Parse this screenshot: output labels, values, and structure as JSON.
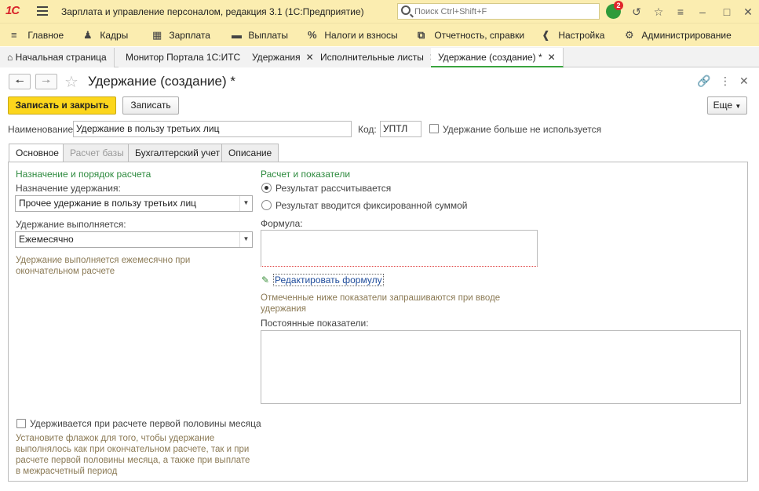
{
  "app": {
    "logo": "1С",
    "title": "Зарплата и управление персоналом, редакция 3.1  (1С:Предприятие)",
    "search_placeholder": "Поиск Ctrl+Shift+F",
    "notifications_count": "2"
  },
  "main_menu": [
    {
      "label": "Главное",
      "icon": "menu-icon"
    },
    {
      "label": "Кадры",
      "icon": "people-icon"
    },
    {
      "label": "Зарплата",
      "icon": "calculator-icon"
    },
    {
      "label": "Выплаты",
      "icon": "wallet-icon"
    },
    {
      "label": "Налоги и взносы",
      "icon": "percent-icon"
    },
    {
      "label": "Отчетность, справки",
      "icon": "reports-icon"
    },
    {
      "label": "Настройка",
      "icon": "wrench-icon"
    },
    {
      "label": "Администрирование",
      "icon": "gear-icon"
    }
  ],
  "window_tabs": [
    {
      "label": "Начальная страница"
    },
    {
      "label": "Монитор Портала 1С:ИТС"
    },
    {
      "label": "Удержания"
    },
    {
      "label": "Исполнительные листы"
    },
    {
      "label": "Удержание (создание) *"
    }
  ],
  "form": {
    "title": "Удержание (создание) *",
    "save_close_label": "Записать и закрыть",
    "save_label": "Записать",
    "more_label": "Еще",
    "name_label": "Наименование:",
    "name_value": "Удержание в пользу третьих лиц",
    "code_label": "Код:",
    "code_value": "УПТЛ",
    "not_used_label": "Удержание больше не используется"
  },
  "tabs": [
    {
      "label": "Основное"
    },
    {
      "label": "Расчет базы"
    },
    {
      "label": "Бухгалтерский учет"
    },
    {
      "label": "Описание"
    }
  ],
  "left": {
    "section_title": "Назначение и порядок расчета",
    "purpose_label": "Назначение удержания:",
    "purpose_value": "Прочее удержание в пользу третьих лиц",
    "performed_label": "Удержание выполняется:",
    "performed_value": "Ежемесячно",
    "performed_hint": "Удержание выполняется ежемесячно при окончательном расчете",
    "first_half_label": "Удерживается при расчете первой половины месяца",
    "first_half_hint": "Установите флажок для того, чтобы удержание выполнялось как при окончательном расчете, так и при расчете первой половины месяца, а также при выплате в межрасчетный период"
  },
  "right": {
    "section_title": "Расчет и показатели",
    "radio_calculated": "Результат рассчитывается",
    "radio_fixed": "Результат вводится фиксированной суммой",
    "formula_label": "Формула:",
    "edit_formula_link": "Редактировать формулу",
    "indicators_hint": "Отмеченные ниже показатели запрашиваются при вводе удержания",
    "constant_indicators_label": "Постоянные показатели:"
  }
}
